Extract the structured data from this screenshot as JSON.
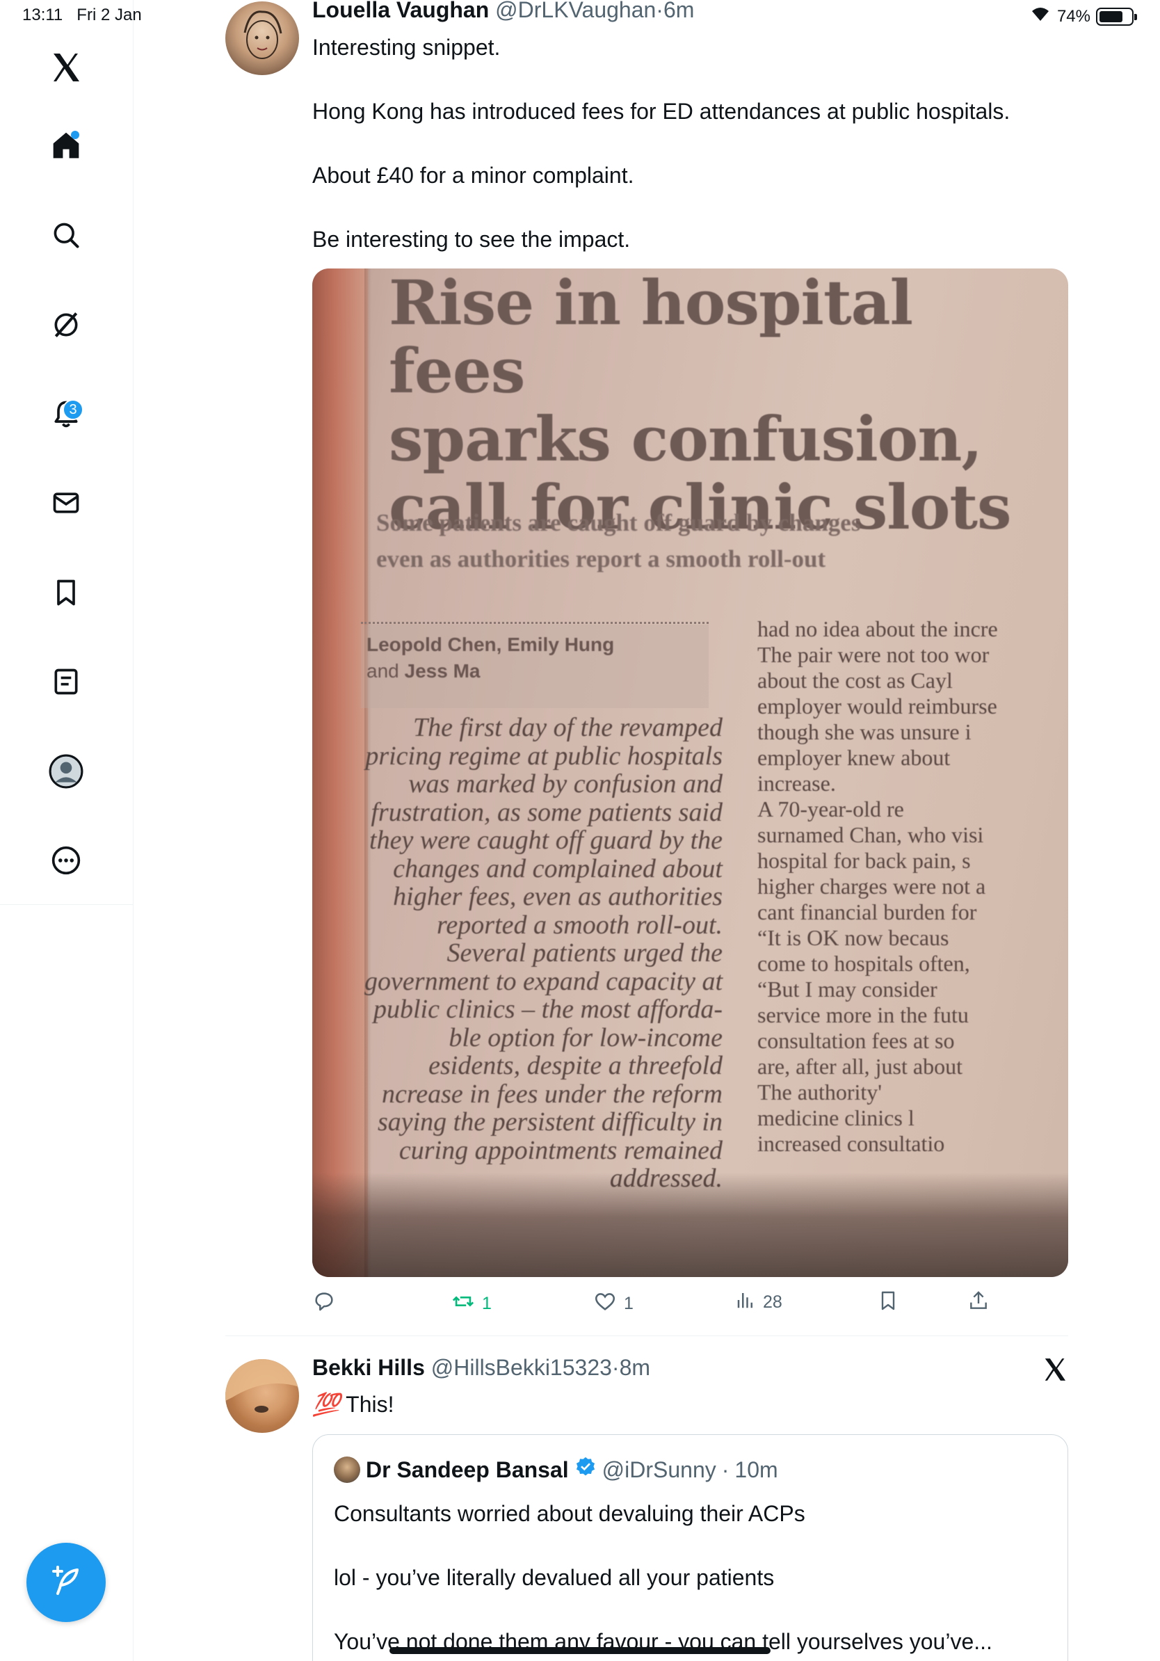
{
  "status_bar": {
    "time": "13:11",
    "date": "Fri 2 Jan",
    "battery": "74%",
    "battery_level": 0.74,
    "icons": [
      "wifi-icon",
      "battery-icon"
    ]
  },
  "sidebar": {
    "items": [
      {
        "name": "x-logo",
        "icon": "x-logo-icon"
      },
      {
        "name": "home",
        "icon": "home-icon",
        "active": true,
        "has_dot": true
      },
      {
        "name": "explore",
        "icon": "search-icon"
      },
      {
        "name": "grok",
        "icon": "grok-icon"
      },
      {
        "name": "notifications",
        "icon": "bell-icon",
        "badge": "3"
      },
      {
        "name": "messages",
        "icon": "envelope-icon"
      },
      {
        "name": "bookmarks",
        "icon": "bookmark-icon"
      },
      {
        "name": "lists",
        "icon": "list-icon"
      },
      {
        "name": "profile",
        "icon": "user-avatar-icon"
      },
      {
        "name": "more",
        "icon": "more-circle-icon"
      }
    ],
    "compose_icon": "compose-feather-icon",
    "accent_color": "#1d9bf0"
  },
  "tweets": [
    {
      "author_name": "Louella Vaughan",
      "author_handle": "@DrLKVaughan",
      "time": "6m",
      "paragraphs": [
        "Interesting snippet.",
        "Hong Kong has introduced fees for ED attendances at public hospitals.",
        "About £40 for a minor complaint.",
        "Be interesting to see the impact."
      ],
      "media": {
        "headline": [
          "Rise in hospital fees",
          "sparks confusion,",
          "call for clinic slots"
        ],
        "standfirst": [
          "Some patients are caught off guard by changes",
          "even as authorities report a smooth roll-out"
        ],
        "byline_authors": "Leopold Chen, Emily Hung",
        "byline_and": "and",
        "byline_last": "Jess Ma",
        "left_column": [
          "The first day of the revamped",
          "pricing regime at public hospitals",
          "was marked by confusion and",
          "frustration, as some patients said",
          "they were caught off guard by the",
          "changes and complained about",
          "higher fees, even as authorities",
          "reported a smooth roll-out.",
          "Several patients urged the",
          "government to expand capacity at",
          "public clinics – the most afforda-",
          "ble option for low-income",
          "esidents, despite a threefold",
          "ncrease in fees under the reform",
          "saying the persistent difficulty in",
          "curing appointments remained",
          "addressed."
        ],
        "right_column": [
          "had no idea about the incre",
          "The pair were not too wor",
          "about the cost as Cayl",
          "employer would reimburse",
          "though she was unsure i",
          "employer knew about",
          "increase.",
          "A 70-year-old re",
          "surnamed Chan, who visi",
          "hospital for back pain, s",
          "higher charges were not a",
          "cant financial burden for",
          "“It is OK now becaus",
          "come to hospitals often,",
          "“But I may consider",
          "service more in the futu",
          "consultation fees at so",
          "are, after all, just about",
          "The authority'",
          "medicine clinics l",
          "increased consultatio"
        ]
      },
      "actions": {
        "reply_count": "",
        "retweet_count": "1",
        "like_count": "1",
        "views_count": "28",
        "retweet_color": "#00ba7c"
      }
    },
    {
      "author_name": "Bekki Hills",
      "author_handle": "@HillsBekki15323",
      "time": "8m",
      "emoji": "💯",
      "text": "This!",
      "quote": {
        "author_name": "Dr Sandeep Bansal",
        "author_handle": "@iDrSunny",
        "time": "10m",
        "verified": true,
        "paragraphs": [
          "Consultants worried about devaluing their ACPs",
          "lol - you’ve literally devalued all your patients",
          "You’ve not done them any favour - you can tell yourselves you’ve..."
        ]
      }
    }
  ],
  "separator": "·"
}
